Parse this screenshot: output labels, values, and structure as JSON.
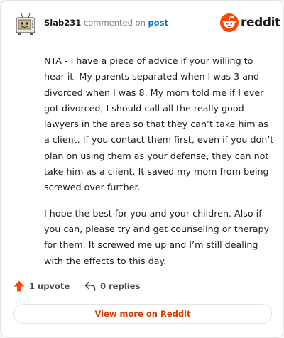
{
  "header": {
    "username": "Slab231",
    "action_text": "commented on",
    "post_link": "post"
  },
  "brand": {
    "wordmark": "reddit",
    "icon": "reddit-snoo-icon",
    "color": "#ff4500"
  },
  "comment": {
    "paragraphs": [
      "NTA - I have a piece of advice if your willing to hear it. My parents separated when I was 3 and divorced when I was 8. My mom told me if I ever got divorced, I should call all the really good lawyers in the area so that they can’t take him as a client. If you contact them first, even if you don’t plan on using them as your defense, they can not take him as a client. It saved my mom from being screwed over further.",
      "I hope the best for you and your children. Also if you can, please try and get counseling or therapy for them. It screwed me up and I’m still dealing with the effects to this day."
    ]
  },
  "actions": {
    "upvote_label": "1 upvote",
    "upvote_icon": "upvote-arrow-icon",
    "upvote_color": "#ff4500",
    "replies_label": "0 replies",
    "replies_icon": "reply-arrow-icon"
  },
  "footer": {
    "view_more_label": "View more on Reddit",
    "accent_color": "#d93a00"
  }
}
